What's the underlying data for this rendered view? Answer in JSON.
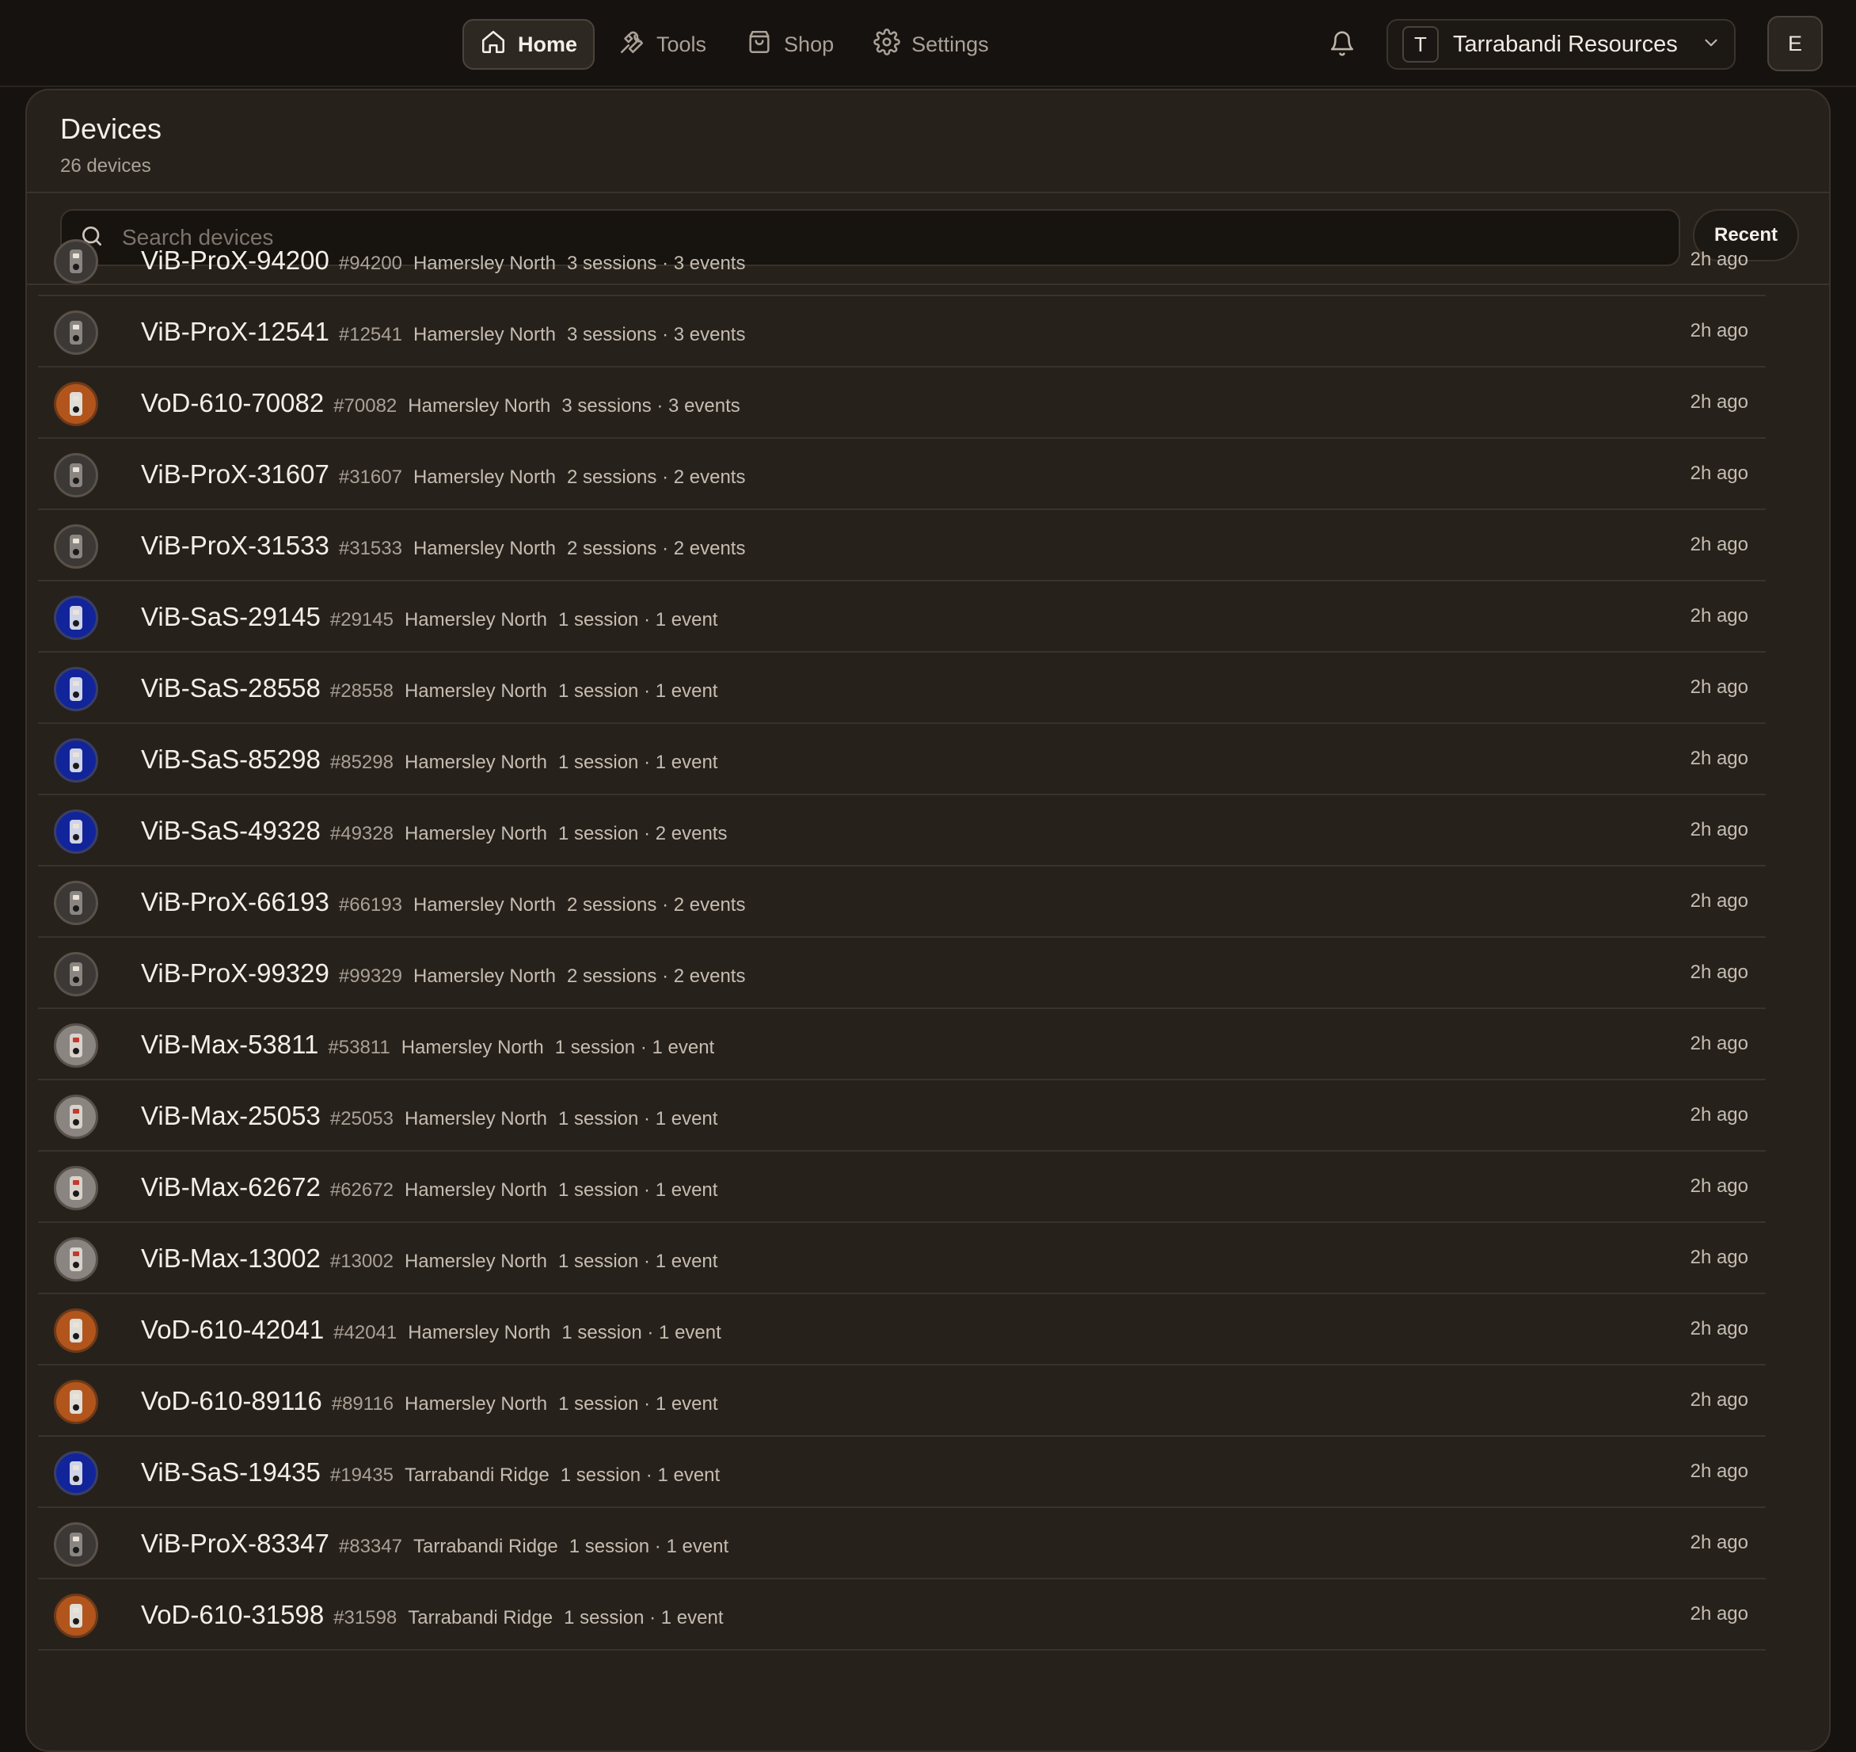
{
  "nav": {
    "items": [
      {
        "label": "Home",
        "icon": "home-icon",
        "active": true
      },
      {
        "label": "Tools",
        "icon": "wrench-icon",
        "active": false
      },
      {
        "label": "Shop",
        "icon": "shopping-bag-icon",
        "active": false
      },
      {
        "label": "Settings",
        "icon": "gear-icon",
        "active": false
      }
    ]
  },
  "header": {
    "org_initial": "T",
    "org_name": "Tarrabandi Resources",
    "user_initial": "E"
  },
  "page": {
    "title": "Devices",
    "subtitle": "26 devices"
  },
  "search": {
    "placeholder": "Search devices",
    "value": ""
  },
  "sort_button": "Recent",
  "colors": {
    "background": "#16120f",
    "card": "#27211b",
    "border": "#3a332c",
    "vod_icon": "#b2551c",
    "sas_icon": "#12249a",
    "prox_icon": "#3b3835",
    "max_icon": "#8a8580"
  },
  "devices": [
    {
      "name": "ViB-ProX-94200",
      "id": "#94200",
      "site": "Hamersley North",
      "stats": "3 sessions · 3 events",
      "time": "2h ago",
      "kind": "pro"
    },
    {
      "name": "ViB-ProX-12541",
      "id": "#12541",
      "site": "Hamersley North",
      "stats": "3 sessions · 3 events",
      "time": "2h ago",
      "kind": "pro"
    },
    {
      "name": "VoD-610-70082",
      "id": "#70082",
      "site": "Hamersley North",
      "stats": "3 sessions · 3 events",
      "time": "2h ago",
      "kind": "vod"
    },
    {
      "name": "ViB-ProX-31607",
      "id": "#31607",
      "site": "Hamersley North",
      "stats": "2 sessions · 2 events",
      "time": "2h ago",
      "kind": "pro"
    },
    {
      "name": "ViB-ProX-31533",
      "id": "#31533",
      "site": "Hamersley North",
      "stats": "2 sessions · 2 events",
      "time": "2h ago",
      "kind": "pro"
    },
    {
      "name": "ViB-SaS-29145",
      "id": "#29145",
      "site": "Hamersley North",
      "stats": "1 session · 1 event",
      "time": "2h ago",
      "kind": "sas"
    },
    {
      "name": "ViB-SaS-28558",
      "id": "#28558",
      "site": "Hamersley North",
      "stats": "1 session · 1 event",
      "time": "2h ago",
      "kind": "sas"
    },
    {
      "name": "ViB-SaS-85298",
      "id": "#85298",
      "site": "Hamersley North",
      "stats": "1 session · 1 event",
      "time": "2h ago",
      "kind": "sas"
    },
    {
      "name": "ViB-SaS-49328",
      "id": "#49328",
      "site": "Hamersley North",
      "stats": "1 session · 2 events",
      "time": "2h ago",
      "kind": "sas"
    },
    {
      "name": "ViB-ProX-66193",
      "id": "#66193",
      "site": "Hamersley North",
      "stats": "2 sessions · 2 events",
      "time": "2h ago",
      "kind": "pro"
    },
    {
      "name": "ViB-ProX-99329",
      "id": "#99329",
      "site": "Hamersley North",
      "stats": "2 sessions · 2 events",
      "time": "2h ago",
      "kind": "pro"
    },
    {
      "name": "ViB-Max-53811",
      "id": "#53811",
      "site": "Hamersley North",
      "stats": "1 session · 1 event",
      "time": "2h ago",
      "kind": "max"
    },
    {
      "name": "ViB-Max-25053",
      "id": "#25053",
      "site": "Hamersley North",
      "stats": "1 session · 1 event",
      "time": "2h ago",
      "kind": "max"
    },
    {
      "name": "ViB-Max-62672",
      "id": "#62672",
      "site": "Hamersley North",
      "stats": "1 session · 1 event",
      "time": "2h ago",
      "kind": "max"
    },
    {
      "name": "ViB-Max-13002",
      "id": "#13002",
      "site": "Hamersley North",
      "stats": "1 session · 1 event",
      "time": "2h ago",
      "kind": "max"
    },
    {
      "name": "VoD-610-42041",
      "id": "#42041",
      "site": "Hamersley North",
      "stats": "1 session · 1 event",
      "time": "2h ago",
      "kind": "vod"
    },
    {
      "name": "VoD-610-89116",
      "id": "#89116",
      "site": "Hamersley North",
      "stats": "1 session · 1 event",
      "time": "2h ago",
      "kind": "vod"
    },
    {
      "name": "ViB-SaS-19435",
      "id": "#19435",
      "site": "Tarrabandi Ridge",
      "stats": "1 session · 1 event",
      "time": "2h ago",
      "kind": "sas"
    },
    {
      "name": "ViB-ProX-83347",
      "id": "#83347",
      "site": "Tarrabandi Ridge",
      "stats": "1 session · 1 event",
      "time": "2h ago",
      "kind": "pro"
    },
    {
      "name": "VoD-610-31598",
      "id": "#31598",
      "site": "Tarrabandi Ridge",
      "stats": "1 session · 1 event",
      "time": "2h ago",
      "kind": "vod"
    }
  ]
}
